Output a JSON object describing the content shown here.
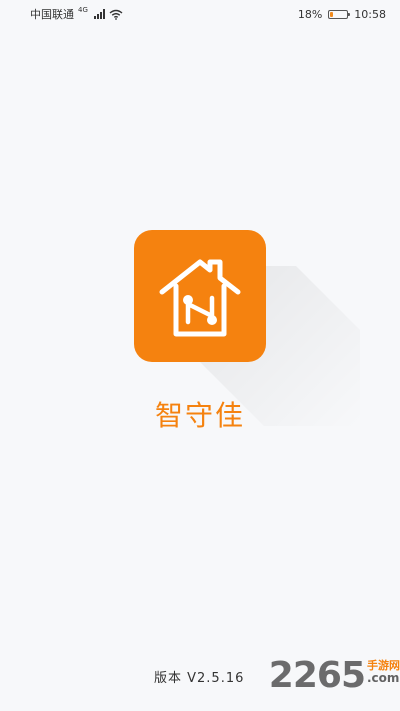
{
  "status_bar": {
    "carrier": "中国联通",
    "network_type": "4G",
    "battery_percent_label": "18%",
    "battery_level": 0.18,
    "time": "10:58"
  },
  "splash": {
    "app_name": "智守佳",
    "version_label": "版本  V2.5.16",
    "brand_color": "#f5820f",
    "icon": "home-network-icon"
  },
  "watermark": {
    "number": "2265",
    "side_top": "手游网",
    "side_bottom": ".com"
  }
}
